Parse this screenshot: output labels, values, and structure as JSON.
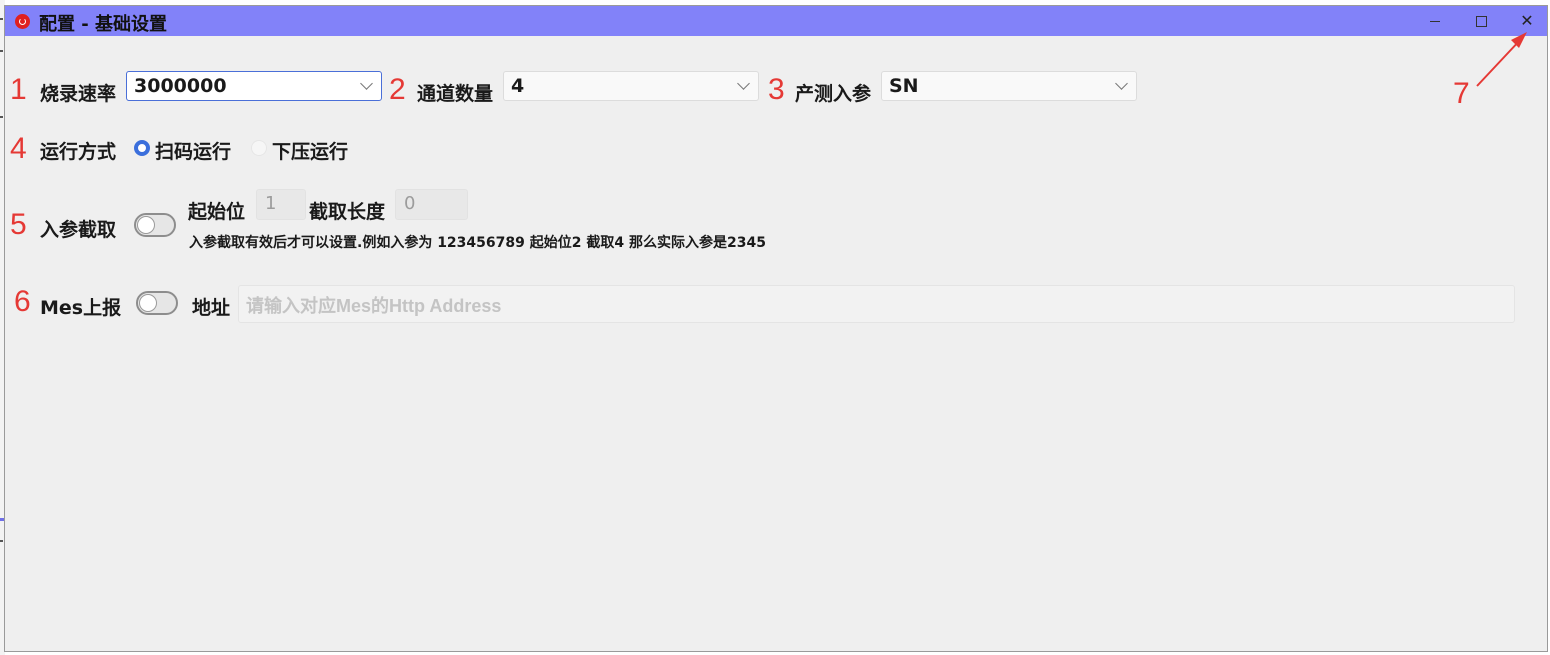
{
  "window": {
    "title": "配置 - 基础设置"
  },
  "annotations": [
    "1",
    "2",
    "3",
    "4",
    "5",
    "6",
    "7"
  ],
  "accent_color": "#3b6fdc",
  "titlebar_color": "#8282f9",
  "annotation_color": "#e53935",
  "fields": {
    "burn_rate": {
      "label": "烧录速率",
      "value": "3000000"
    },
    "channel_count": {
      "label": "通道数量",
      "value": "4"
    },
    "test_param": {
      "label": "产测入参",
      "value": "SN"
    }
  },
  "run_mode": {
    "label": "运行方式",
    "options": [
      {
        "label": "扫码运行",
        "selected": true
      },
      {
        "label": "下压运行",
        "selected": false
      }
    ]
  },
  "param_trim": {
    "label": "入参截取",
    "enabled": false,
    "start_label": "起始位",
    "start_value": "1",
    "length_label": "截取长度",
    "length_value": "0",
    "hint": "入参截取有效后才可以设置.例如入参为 123456789 起始位2 截取4 那么实际入参是2345"
  },
  "mes": {
    "label": "Mes上报",
    "enabled": false,
    "address_label": "地址",
    "address_placeholder": "请输入对应Mes的Http Address"
  }
}
